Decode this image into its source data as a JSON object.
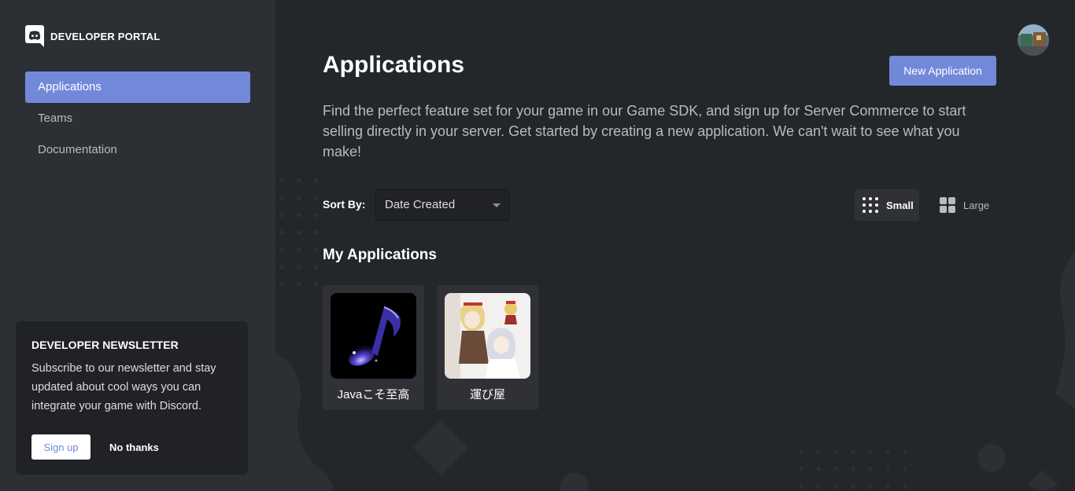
{
  "brand": {
    "title": "DEVELOPER PORTAL",
    "icon": "discord-logo-icon"
  },
  "nav": {
    "items": [
      {
        "label": "Applications",
        "active": true
      },
      {
        "label": "Teams",
        "active": false
      },
      {
        "label": "Documentation",
        "active": false
      }
    ]
  },
  "newsletter": {
    "title": "DEVELOPER NEWSLETTER",
    "body": "Subscribe to our newsletter and stay updated about cool ways you can integrate your game with Discord.",
    "signup_label": "Sign up",
    "decline_label": "No thanks"
  },
  "main": {
    "title": "Applications",
    "new_app_label": "New Application",
    "intro": "Find the perfect feature set for your game in our Game SDK, and sign up for Server Commerce to start selling directly in your server. Get started by creating a new application. We can't wait to see what you make!",
    "sort_label": "Sort By:",
    "sort_value": "Date Created",
    "view_small_label": "Small",
    "view_large_label": "Large",
    "section_title": "My Applications",
    "apps": [
      {
        "name": "Javaこそ至高"
      },
      {
        "name": "運び屋"
      }
    ]
  },
  "colors": {
    "accent": "#7289da",
    "sidebar_bg": "#2c2f33",
    "main_bg": "#23272a",
    "card_bg": "#2f3136",
    "popup_bg": "#202225"
  }
}
